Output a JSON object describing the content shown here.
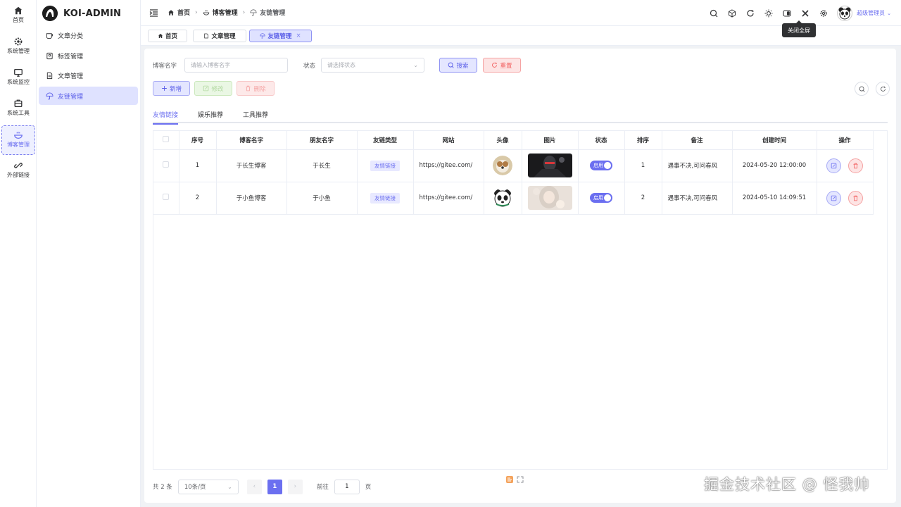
{
  "rail": {
    "items": [
      {
        "label": "首页",
        "icon": "home-icon"
      },
      {
        "label": "系统管理",
        "icon": "gear-icon"
      },
      {
        "label": "系统监控",
        "icon": "monitor-icon"
      },
      {
        "label": "系统工具",
        "icon": "toolbox-icon"
      },
      {
        "label": "博客管理",
        "icon": "bowl-icon"
      },
      {
        "label": "外部链接",
        "icon": "link-icon"
      }
    ],
    "active_index": 4
  },
  "sidebar": {
    "logo_text": "KOI-ADMIN",
    "items": [
      {
        "label": "文章分类",
        "icon": "cup-icon"
      },
      {
        "label": "标签管理",
        "icon": "tag-icon"
      },
      {
        "label": "文章管理",
        "icon": "document-icon"
      },
      {
        "label": "友链管理",
        "icon": "umbrella-icon"
      }
    ],
    "active_index": 3
  },
  "header": {
    "breadcrumbs": [
      "首页",
      "博客管理",
      "友链管理"
    ],
    "user_name": "超级管理员",
    "tooltip": "关闭全屏"
  },
  "tabs": [
    {
      "label": "首页",
      "icon": "home-icon"
    },
    {
      "label": "文章管理",
      "icon": "document-icon"
    },
    {
      "label": "友链管理",
      "icon": "umbrella-icon",
      "closable": "×"
    }
  ],
  "search": {
    "name_label": "博客名字",
    "name_placeholder": "请输入博客名字",
    "status_label": "状态",
    "status_placeholder": "请选择状态",
    "search_button": "搜索",
    "reset_button": "重置"
  },
  "toolbar": {
    "add_button": "新增",
    "edit_button": "修改",
    "delete_button": "删除"
  },
  "subtabs": [
    "友情链接",
    "娱乐推荐",
    "工具推荐"
  ],
  "table": {
    "columns": [
      "序号",
      "博客名字",
      "朋友名字",
      "友链类型",
      "网站",
      "头像",
      "图片",
      "状态",
      "排序",
      "备注",
      "创建时间",
      "操作"
    ],
    "rows": [
      {
        "no": "1",
        "blog": "于长生博客",
        "friend": "于长生",
        "type": "友情链接",
        "site": "https://gitee.com/",
        "status": "启用",
        "sort": "1",
        "remark": "遇事不决,可问春风",
        "created": "2024-05-20 12:00:00"
      },
      {
        "no": "2",
        "blog": "于小鱼博客",
        "friend": "于小鱼",
        "type": "友情链接",
        "site": "https://gitee.com/",
        "status": "启用",
        "sort": "2",
        "remark": "遇事不决,可问春风",
        "created": "2024-05-10 14:09:51"
      }
    ]
  },
  "pager": {
    "total": "共 2 条",
    "page_size": "10条/页",
    "current": "1",
    "goto_label": "前往",
    "goto_value": "1",
    "goto_suffix": "页"
  },
  "watermark": "掘金技术社区 @ 怪我帅",
  "colors": {
    "accent": "#6b6ff0",
    "danger": "#f26161",
    "success": "#9fd18c"
  }
}
